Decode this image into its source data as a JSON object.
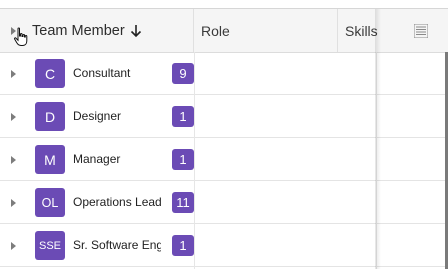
{
  "columns": {
    "team_member": "Team Member",
    "role": "Role",
    "skills": "Skills",
    "sort_icon": "arrow-down-icon",
    "menu_icon": "column-menu-icon"
  },
  "rows": [
    {
      "initials": "C",
      "name": "Consultant",
      "count": "9"
    },
    {
      "initials": "D",
      "name": "Designer",
      "count": "1"
    },
    {
      "initials": "M",
      "name": "Manager",
      "count": "1"
    },
    {
      "initials": "OL",
      "name": "Operations Lead",
      "count": "11"
    },
    {
      "initials": "SSE",
      "name": "Sr. Software Eng",
      "count": "1"
    }
  ],
  "colors": {
    "badge": "#6b4bb5",
    "header_bg": "#f5f5f5"
  }
}
